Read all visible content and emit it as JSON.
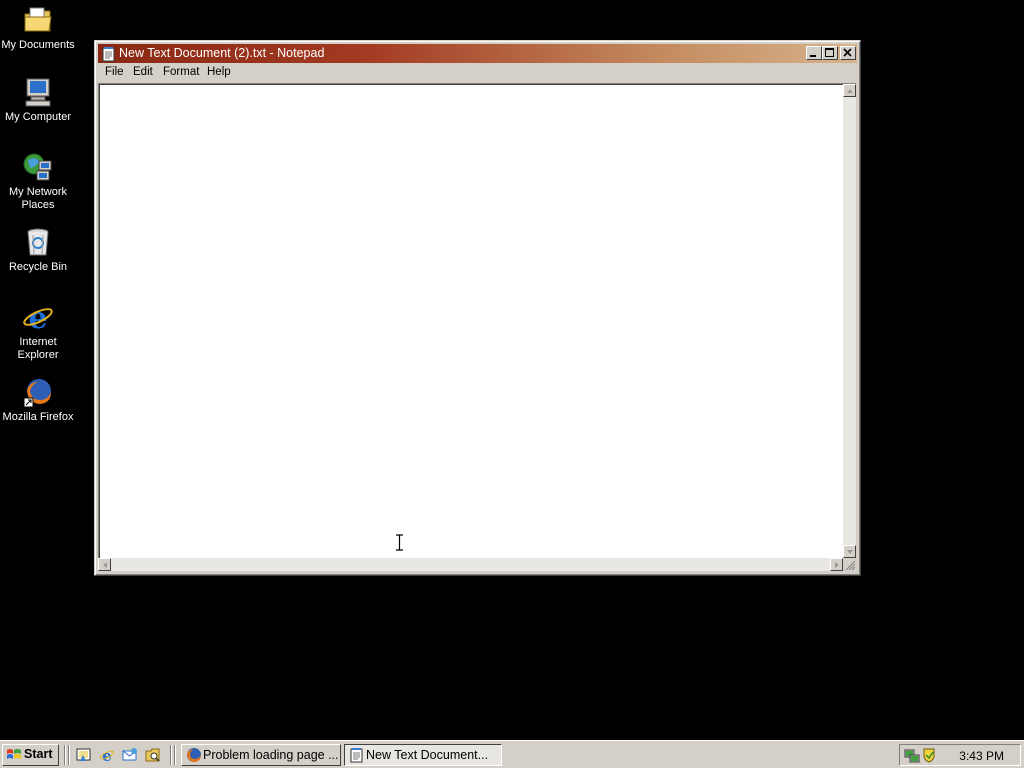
{
  "desktop": {
    "icons": [
      {
        "label": "My Documents",
        "icon": "folder-documents-icon"
      },
      {
        "label": "My Computer",
        "icon": "computer-icon"
      },
      {
        "label": "My Network Places",
        "icon": "network-icon"
      },
      {
        "label": "Recycle Bin",
        "icon": "recycle-bin-icon"
      },
      {
        "label": "Internet Explorer",
        "icon": "internet-explorer-icon"
      },
      {
        "label": "Mozilla Firefox",
        "icon": "firefox-icon"
      }
    ]
  },
  "window": {
    "title": "New Text Document (2).txt - Notepad",
    "menu": [
      "File",
      "Edit",
      "Format",
      "Help"
    ],
    "content": "",
    "colors": {
      "title_start": "#8a2814",
      "title_end": "#d7b38c"
    }
  },
  "taskbar": {
    "start_label": "Start",
    "quick_launch": [
      "show-desktop-icon",
      "internet-explorer-icon",
      "outlook-express-icon",
      "explorer-icon"
    ],
    "tasks": [
      {
        "label": "Problem loading page ...",
        "icon": "firefox-icon",
        "active": false
      },
      {
        "label": "New Text Document...",
        "icon": "notepad-icon",
        "active": true
      }
    ],
    "clock": "3:43 PM"
  }
}
